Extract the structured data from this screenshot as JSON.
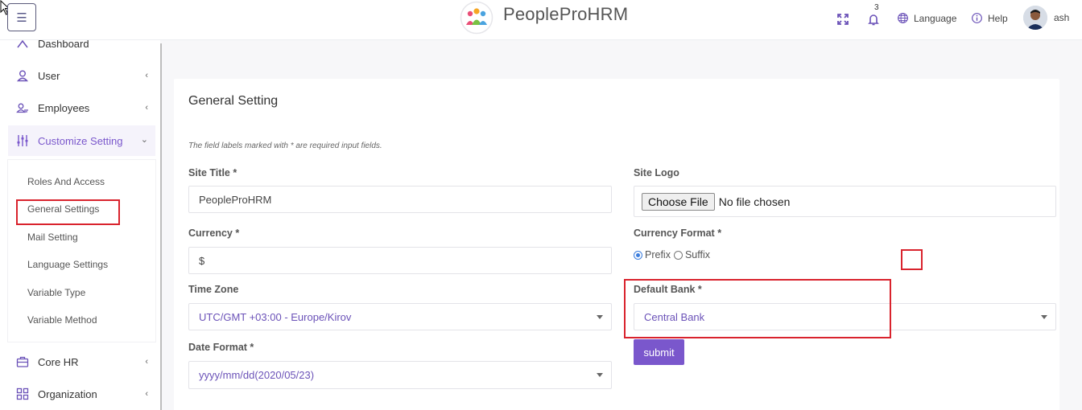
{
  "header": {
    "brand": "PeopleProHRM",
    "notification_count": "3",
    "language_label": "Language",
    "help_label": "Help",
    "user_name": "ash"
  },
  "sidebar": {
    "items": [
      {
        "label": "Dashboard",
        "icon": "dashboard-icon"
      },
      {
        "label": "User",
        "icon": "user-icon"
      },
      {
        "label": "Employees",
        "icon": "employees-icon"
      },
      {
        "label": "Customize Setting",
        "icon": "sliders-icon",
        "expanded": true
      },
      {
        "label": "Core HR",
        "icon": "briefcase-icon"
      },
      {
        "label": "Organization",
        "icon": "grid-icon"
      }
    ],
    "subitems": [
      "Roles And Access",
      "General Settings",
      "Mail Setting",
      "Language Settings",
      "Variable Type",
      "Variable Method"
    ]
  },
  "form": {
    "title": "General Setting",
    "note": "The field labels marked with * are required input fields.",
    "site_title_label": "Site Title *",
    "site_title_value": "PeopleProHRM",
    "site_logo_label": "Site Logo",
    "choose_file": "Choose File",
    "no_file": "No file chosen",
    "currency_label": "Currency *",
    "currency_value": "$",
    "currency_format_label": "Currency Format *",
    "prefix_label": "Prefix",
    "suffix_label": "Suffix",
    "currency_format_selected": "Prefix",
    "time_zone_label": "Time Zone",
    "time_zone_value": "UTC/GMT +03:00 - Europe/Kirov",
    "default_bank_label": "Default Bank *",
    "default_bank_value": "Central Bank",
    "date_format_label": "Date Format *",
    "date_format_value": "yyyy/mm/dd(2020/05/23)",
    "submit_label": "submit"
  },
  "colors": {
    "accent": "#7a57cc",
    "highlight": "#d9232d"
  }
}
